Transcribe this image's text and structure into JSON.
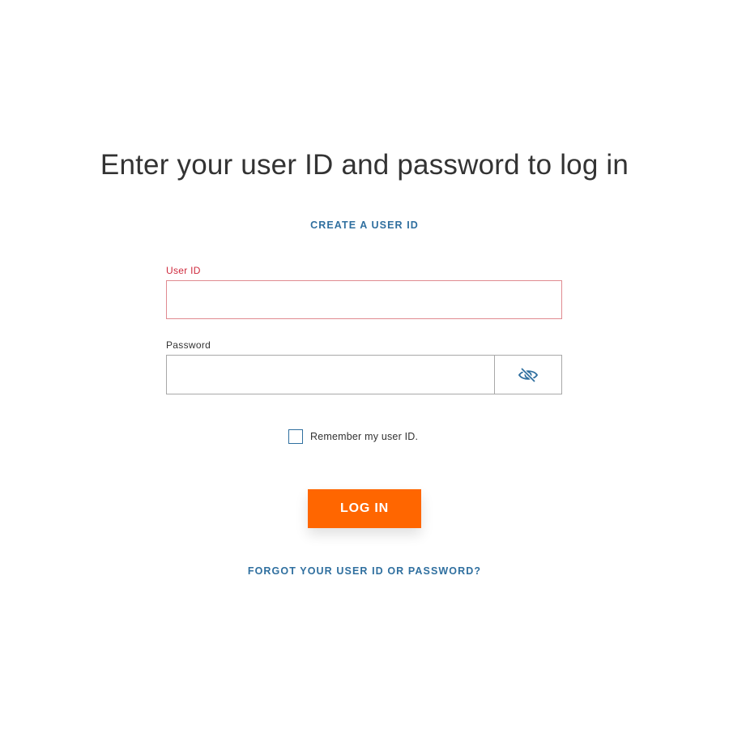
{
  "page": {
    "title": "Enter your user ID and password to log in"
  },
  "links": {
    "create_user_id": "CREATE A USER ID",
    "forgot": "FORGOT YOUR USER ID OR PASSWORD?"
  },
  "form": {
    "user_id": {
      "label": "User ID",
      "value": "",
      "placeholder": ""
    },
    "password": {
      "label": "Password",
      "value": "",
      "placeholder": "",
      "toggle_icon": "eye-slash-icon"
    },
    "remember": {
      "label": "Remember my user ID.",
      "checked": false
    },
    "submit_label": "LOG IN"
  },
  "colors": {
    "accent_blue": "#2f6f9f",
    "error_red": "#cf2a3d",
    "button_orange": "#ff6600"
  }
}
